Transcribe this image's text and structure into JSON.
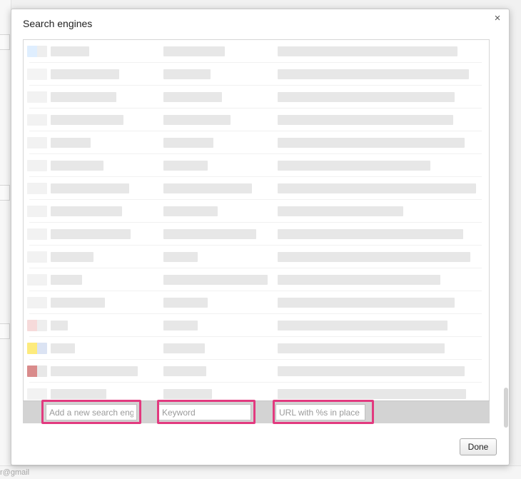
{
  "background": {
    "footer_text": "r@gmail"
  },
  "dialog": {
    "title": "Search engines",
    "close_glyph": "×",
    "close_icon": "close-icon",
    "done_label": "Done",
    "add_row": {
      "name_placeholder": "Add a new search engine",
      "keyword_placeholder": "Keyword",
      "url_placeholder": "URL with %s in place of query"
    },
    "highlight_color": "#e23a7f"
  }
}
